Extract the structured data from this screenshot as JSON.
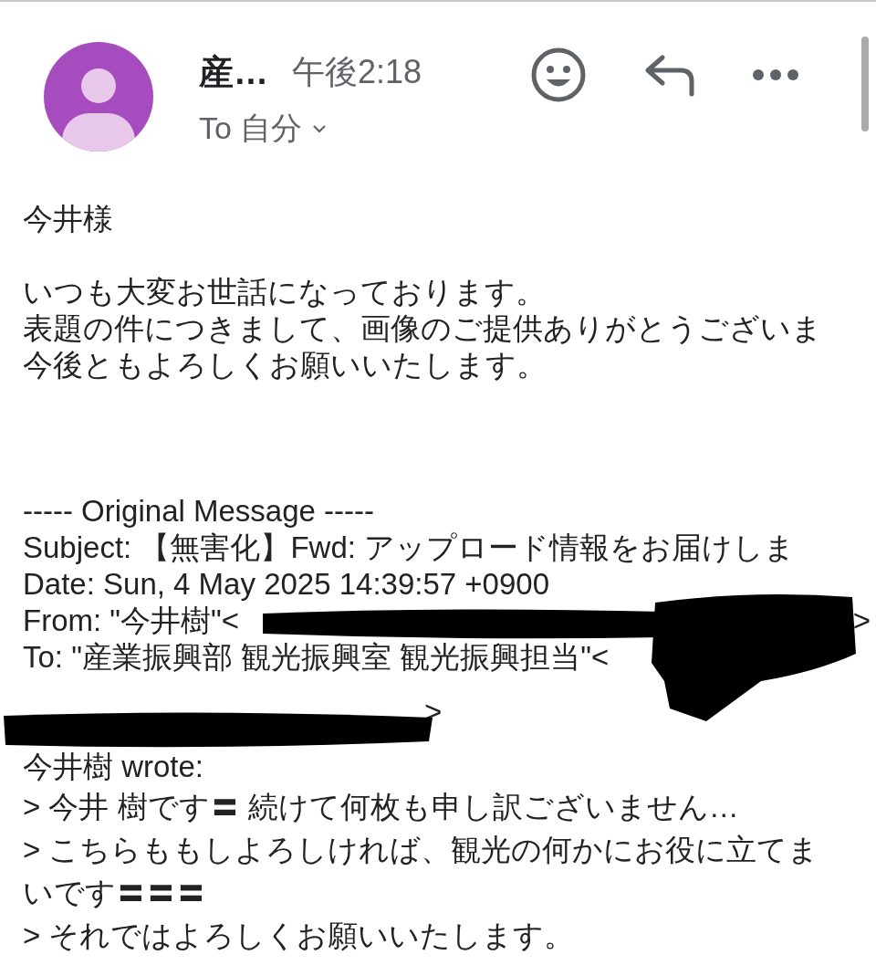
{
  "header": {
    "sender": "産…",
    "time": "午後2:18",
    "recipient": "To 自分"
  },
  "body": [
    {
      "kind": "text",
      "text": "今井様"
    },
    {
      "kind": "blank"
    },
    {
      "kind": "text",
      "text": "いつも大変お世話になっております。"
    },
    {
      "kind": "text",
      "text": "表題の件につきまして、画像のご提供ありがとうございま"
    },
    {
      "kind": "text",
      "text": "今後ともよろしくお願いいたします。"
    },
    {
      "kind": "blank"
    },
    {
      "kind": "blank"
    },
    {
      "kind": "blank"
    },
    {
      "kind": "text",
      "text": "----- Original Message -----"
    },
    {
      "kind": "text",
      "text": "Subject: 【無害化】Fwd: アップロード情報をお届けしま"
    },
    {
      "kind": "text",
      "text": "Date: Sun, 4 May 2025 14:39:57 +0900"
    },
    {
      "kind": "redacted_end",
      "text": "From: \"今井樹\"<",
      "tail": ">"
    },
    {
      "kind": "text",
      "text": "To: \"産業振興部 観光振興室 観光振興担当\"<"
    },
    {
      "kind": "redacted",
      "tail": ">"
    },
    {
      "kind": "text",
      "text": "今井樹 wrote:"
    },
    {
      "kind": "quote",
      "text": "> 今井 樹です〓 続けて何枚も申し訳ございません…"
    },
    {
      "kind": "quote",
      "text": "> こちらももしよろしければ、観光の何かにお役に立てま"
    },
    {
      "kind": "quote",
      "text": "いです〓〓〓"
    },
    {
      "kind": "quote",
      "text": "> それではよろしくお願いいたします。"
    }
  ]
}
